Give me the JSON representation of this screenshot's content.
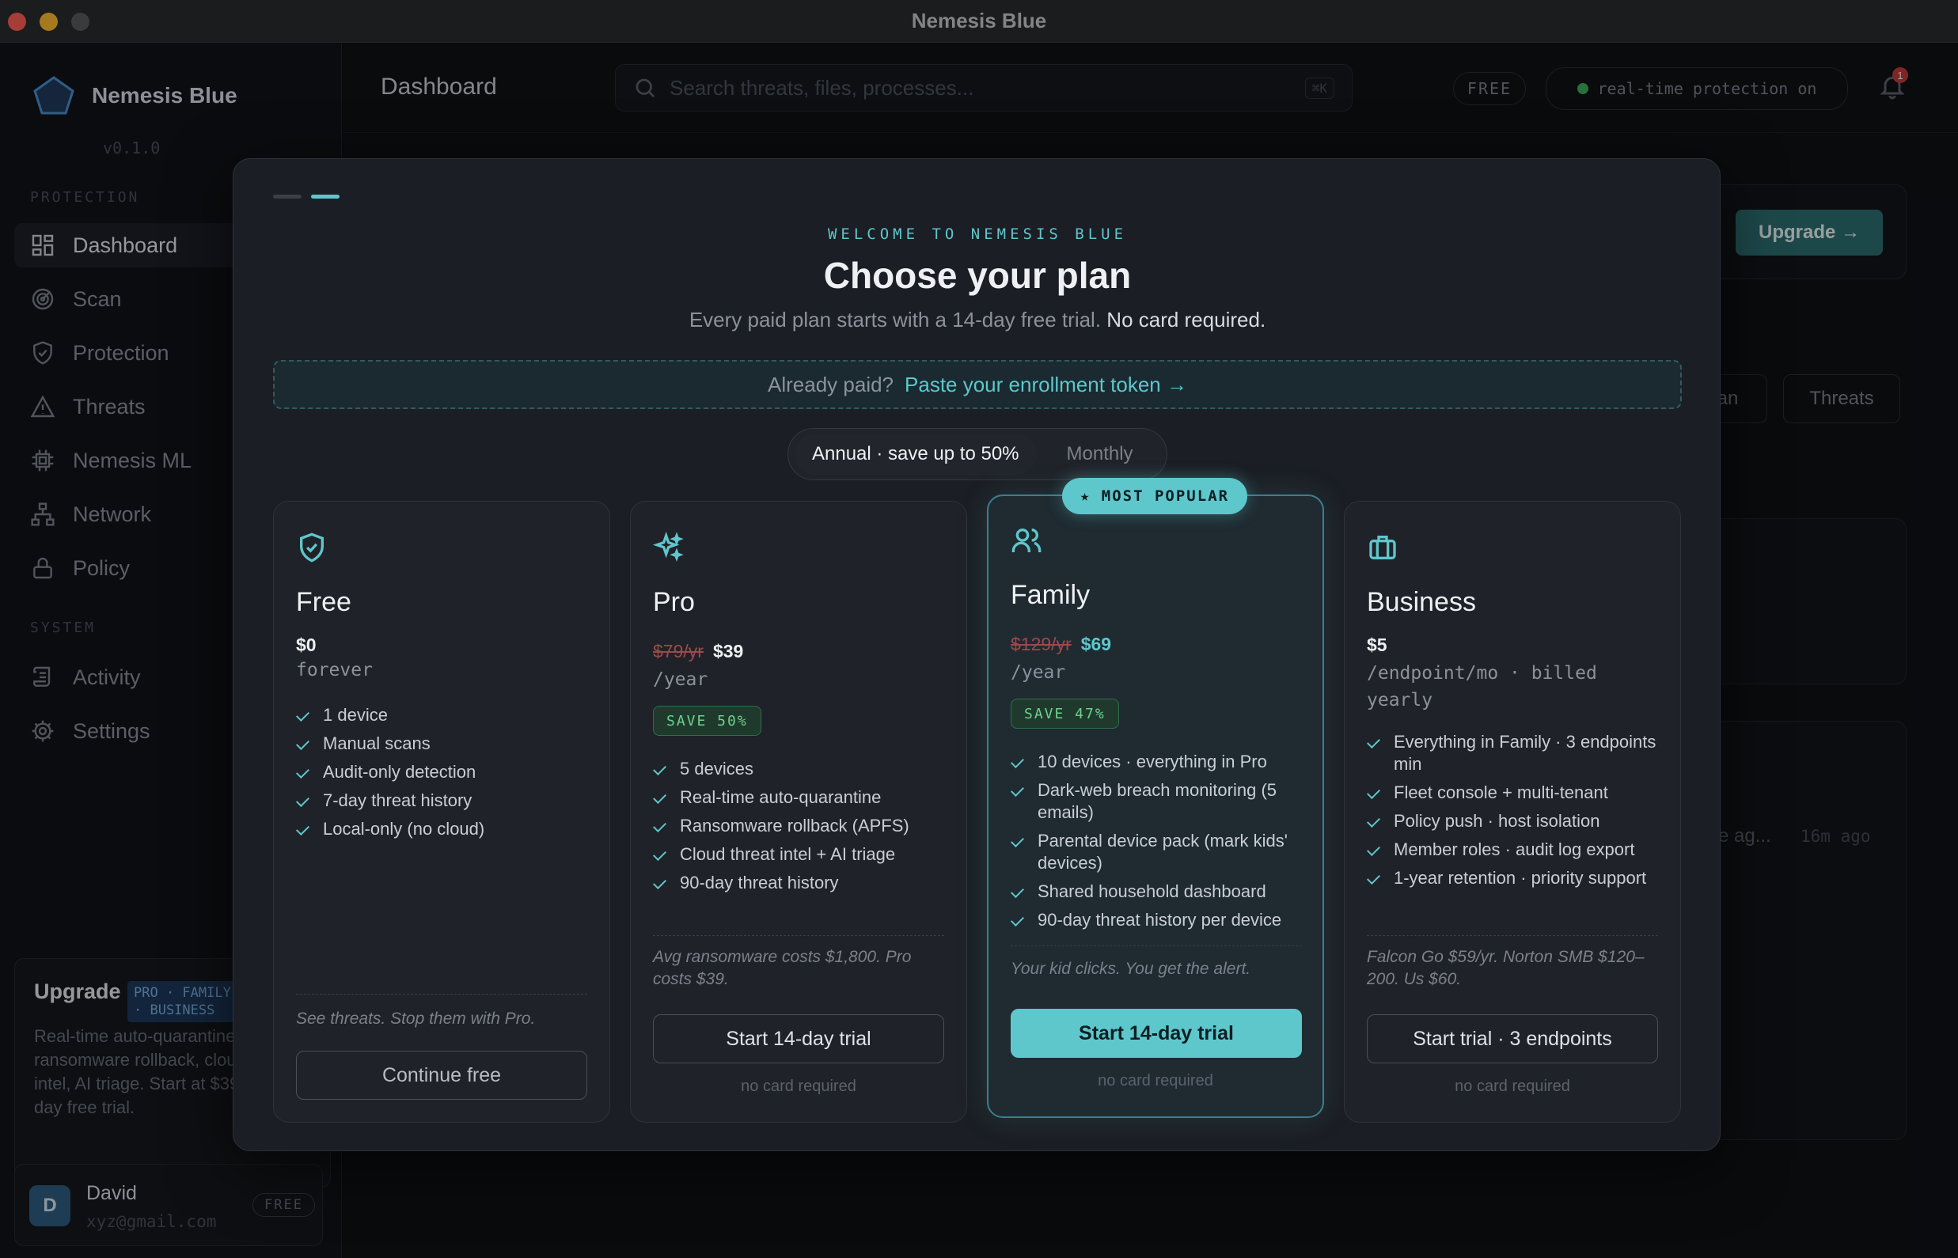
{
  "window": {
    "title": "Nemesis Blue"
  },
  "sidebar": {
    "brand": {
      "name": "Nemesis Blue",
      "version": "v0.1.0"
    },
    "section_protection": "PROTECTION",
    "section_system": "SYSTEM",
    "items": [
      {
        "label": "Dashboard",
        "icon": "dashboard-icon"
      },
      {
        "label": "Scan",
        "icon": "radar-icon"
      },
      {
        "label": "Protection",
        "icon": "shield-check-icon"
      },
      {
        "label": "Threats",
        "icon": "warning-icon"
      },
      {
        "label": "Nemesis ML",
        "icon": "chip-icon"
      },
      {
        "label": "Network",
        "icon": "network-icon"
      },
      {
        "label": "Policy",
        "icon": "lock-icon"
      },
      {
        "label": "Activity",
        "icon": "scroll-icon"
      },
      {
        "label": "Settings",
        "icon": "gear-icon"
      }
    ],
    "upgrade": {
      "title": "Upgrade",
      "badge": "PRO · FAMILY · BUSINESS",
      "text": "Real-time auto-quarantine, ransomware rollback, cloud threat intel, AI triage. Start at $39/year — 14-day free trial."
    },
    "user": {
      "initial": "D",
      "name": "David",
      "email": "xyz@gmail.com",
      "plan": "FREE"
    }
  },
  "header": {
    "title": "Dashboard",
    "search_placeholder": "Search threats, files, processes...",
    "search_shortcut": "⌘K",
    "plan_badge": "FREE",
    "protection_status": "real-time protection on",
    "notification_count": "1"
  },
  "background": {
    "upgrade_button": "Upgrade →",
    "tab_scan_partial": "an",
    "tab_threats": "Threats",
    "activity_partial": "e ag...",
    "activity_time": "16m ago"
  },
  "modal": {
    "eyebrow": "WELCOME TO NEMESIS BLUE",
    "title": "Choose your plan",
    "subtitle_a": "Every paid plan starts with a 14-day free trial.",
    "subtitle_b": "No card required.",
    "token_prompt": "Already paid?",
    "token_link": "Paste your enrollment token →",
    "billing_annual": "Annual · save up to 50%",
    "billing_monthly": "Monthly",
    "popular_label": "★ MOST POPULAR",
    "plans": [
      {
        "name": "Free",
        "icon": "shield-check-icon",
        "price": "$0",
        "period": "forever",
        "features": [
          "1 device",
          "Manual scans",
          "Audit-only detection",
          "7-day threat history",
          "Local-only (no cloud)"
        ],
        "note": "See threats. Stop them with Pro.",
        "cta": "Continue free"
      },
      {
        "name": "Pro",
        "icon": "sparkles-icon",
        "old_price": "$79/yr",
        "price": "$39",
        "period": "/year",
        "save": "SAVE 50%",
        "features": [
          "5 devices",
          "Real-time auto-quarantine",
          "Ransomware rollback (APFS)",
          "Cloud threat intel + AI triage",
          "90-day threat history"
        ],
        "note": "Avg ransomware costs $1,800. Pro costs $39.",
        "cta": "Start 14-day trial",
        "subnote": "no card required"
      },
      {
        "name": "Family",
        "icon": "users-icon",
        "old_price": "$129/yr",
        "price": "$69",
        "period": "/year",
        "save": "SAVE 47%",
        "features": [
          "10 devices · everything in Pro",
          "Dark-web breach monitoring (5 emails)",
          "Parental device pack (mark kids' devices)",
          "Shared household dashboard",
          "90-day threat history per device"
        ],
        "note": "Your kid clicks. You get the alert.",
        "cta": "Start 14-day trial",
        "subnote": "no card required"
      },
      {
        "name": "Business",
        "icon": "briefcase-icon",
        "price": "$5",
        "period": "/endpoint/mo · billed yearly",
        "features": [
          "Everything in Family · 3 endpoints min",
          "Fleet console + multi-tenant",
          "Policy push · host isolation",
          "Member roles · audit log export",
          "1-year retention · priority support"
        ],
        "note": "Falcon Go $59/yr. Norton SMB $120–200. Us $60.",
        "cta": "Start trial · 3 endpoints",
        "subnote": "no card required"
      }
    ]
  },
  "colors": {
    "accent": "#5ec7cc",
    "background": "#0f1115",
    "modal": "#1b1e24",
    "save_green": "#6fd08f"
  }
}
